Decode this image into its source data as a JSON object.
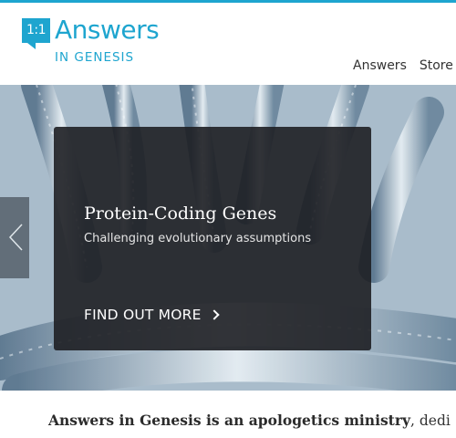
{
  "logo": {
    "badge": "1:1",
    "main": "Answers",
    "sub": "IN GENESIS"
  },
  "nav": {
    "items": [
      "Answers",
      "Store"
    ]
  },
  "hero": {
    "title": "Protein-Coding Genes",
    "subtitle": "Challenging evolutionary assumptions",
    "cta": "FIND OUT MORE"
  },
  "mission": {
    "bold": "Answers in Genesis is an apologetics ministry",
    "rest": ", dedi"
  },
  "colors": {
    "brand": "#1ea5cf",
    "card": "#1e1f24",
    "text": "#333333"
  }
}
